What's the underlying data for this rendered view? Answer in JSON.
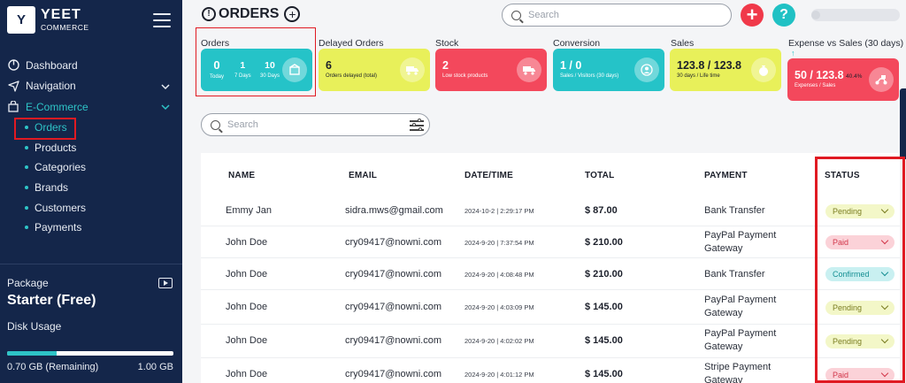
{
  "brand": {
    "mark": "Y",
    "name": "YEET",
    "sub": "COMMERCE"
  },
  "sidebar": {
    "items": [
      {
        "label": "Dashboard"
      },
      {
        "label": "Navigation"
      },
      {
        "label": "E-Commerce"
      }
    ],
    "subitems": [
      {
        "label": "Orders"
      },
      {
        "label": "Products"
      },
      {
        "label": "Categories"
      },
      {
        "label": "Brands"
      },
      {
        "label": "Customers"
      },
      {
        "label": "Payments"
      }
    ],
    "package": {
      "label": "Package",
      "plan": "Starter (Free)",
      "disk_label": "Disk Usage",
      "disk_remaining": "0.70 GB (Remaining)",
      "disk_total": "1.00 GB",
      "disk_used_fraction": 0.3
    }
  },
  "header": {
    "title": "ORDERS",
    "search_placeholder": "Search",
    "help": "?"
  },
  "stats": {
    "orders": {
      "label": "Orders",
      "today": "0",
      "today_label": "Today",
      "days7": "1",
      "days7_label": "7 Days",
      "days30": "10",
      "days30_label": "30 Days"
    },
    "delayed": {
      "label": "Delayed Orders",
      "value": "6",
      "sub": "Orders delayed (total)"
    },
    "stock": {
      "label": "Stock",
      "value": "2",
      "sub": "Low stock products"
    },
    "conversion": {
      "label": "Conversion",
      "value": "1 / 0",
      "sub": "Sales / Visitors (30 days)"
    },
    "sales": {
      "label": "Sales",
      "value": "123.8 / 123.8",
      "sub": "30 days / Life time"
    },
    "expense": {
      "label": "Expense vs Sales (30 days)",
      "arrow": "↑",
      "value": "50 / 123.8",
      "pct": "40.4%",
      "sub": "Expenses / Sales"
    }
  },
  "list": {
    "search_placeholder": "Search"
  },
  "table": {
    "headers": {
      "name": "NAME",
      "email": "EMAIL",
      "date": "DATE/TIME",
      "total": "TOTAL",
      "payment": "PAYMENT",
      "status": "STATUS"
    },
    "rows": [
      {
        "name": "Emmy Jan",
        "email": "sidra.mws@gmail.com",
        "date": "2024-10-2 | 2:29:17 PM",
        "total": "$ 87.00",
        "payment": "Bank Transfer",
        "status": "Pending"
      },
      {
        "name": "John Doe",
        "email": "cry09417@nowni.com",
        "date": "2024-9-20 | 7:37:54 PM",
        "total": "$ 210.00",
        "payment": "PayPal Payment Gateway",
        "status": "Paid"
      },
      {
        "name": "John Doe",
        "email": "cry09417@nowni.com",
        "date": "2024-9-20 | 4:08:48 PM",
        "total": "$ 210.00",
        "payment": "Bank Transfer",
        "status": "Confirmed"
      },
      {
        "name": "John Doe",
        "email": "cry09417@nowni.com",
        "date": "2024-9-20 | 4:03:09 PM",
        "total": "$ 145.00",
        "payment": "PayPal Payment Gateway",
        "status": "Pending"
      },
      {
        "name": "John Doe",
        "email": "cry09417@nowni.com",
        "date": "2024-9-20 | 4:02:02 PM",
        "total": "$ 145.00",
        "payment": "PayPal Payment Gateway",
        "status": "Pending"
      },
      {
        "name": "John Doe",
        "email": "cry09417@nowni.com",
        "date": "2024-9-20 | 4:01:12 PM",
        "total": "$ 145.00",
        "payment": "Stripe Payment Gateway",
        "status": "Paid"
      }
    ]
  },
  "colors": {
    "sidebar_bg": "#14264a",
    "accent_teal": "#25c3c8",
    "accent_red": "#f3485c",
    "accent_yellow": "#e8f05a",
    "highlight": "#e01a22"
  }
}
